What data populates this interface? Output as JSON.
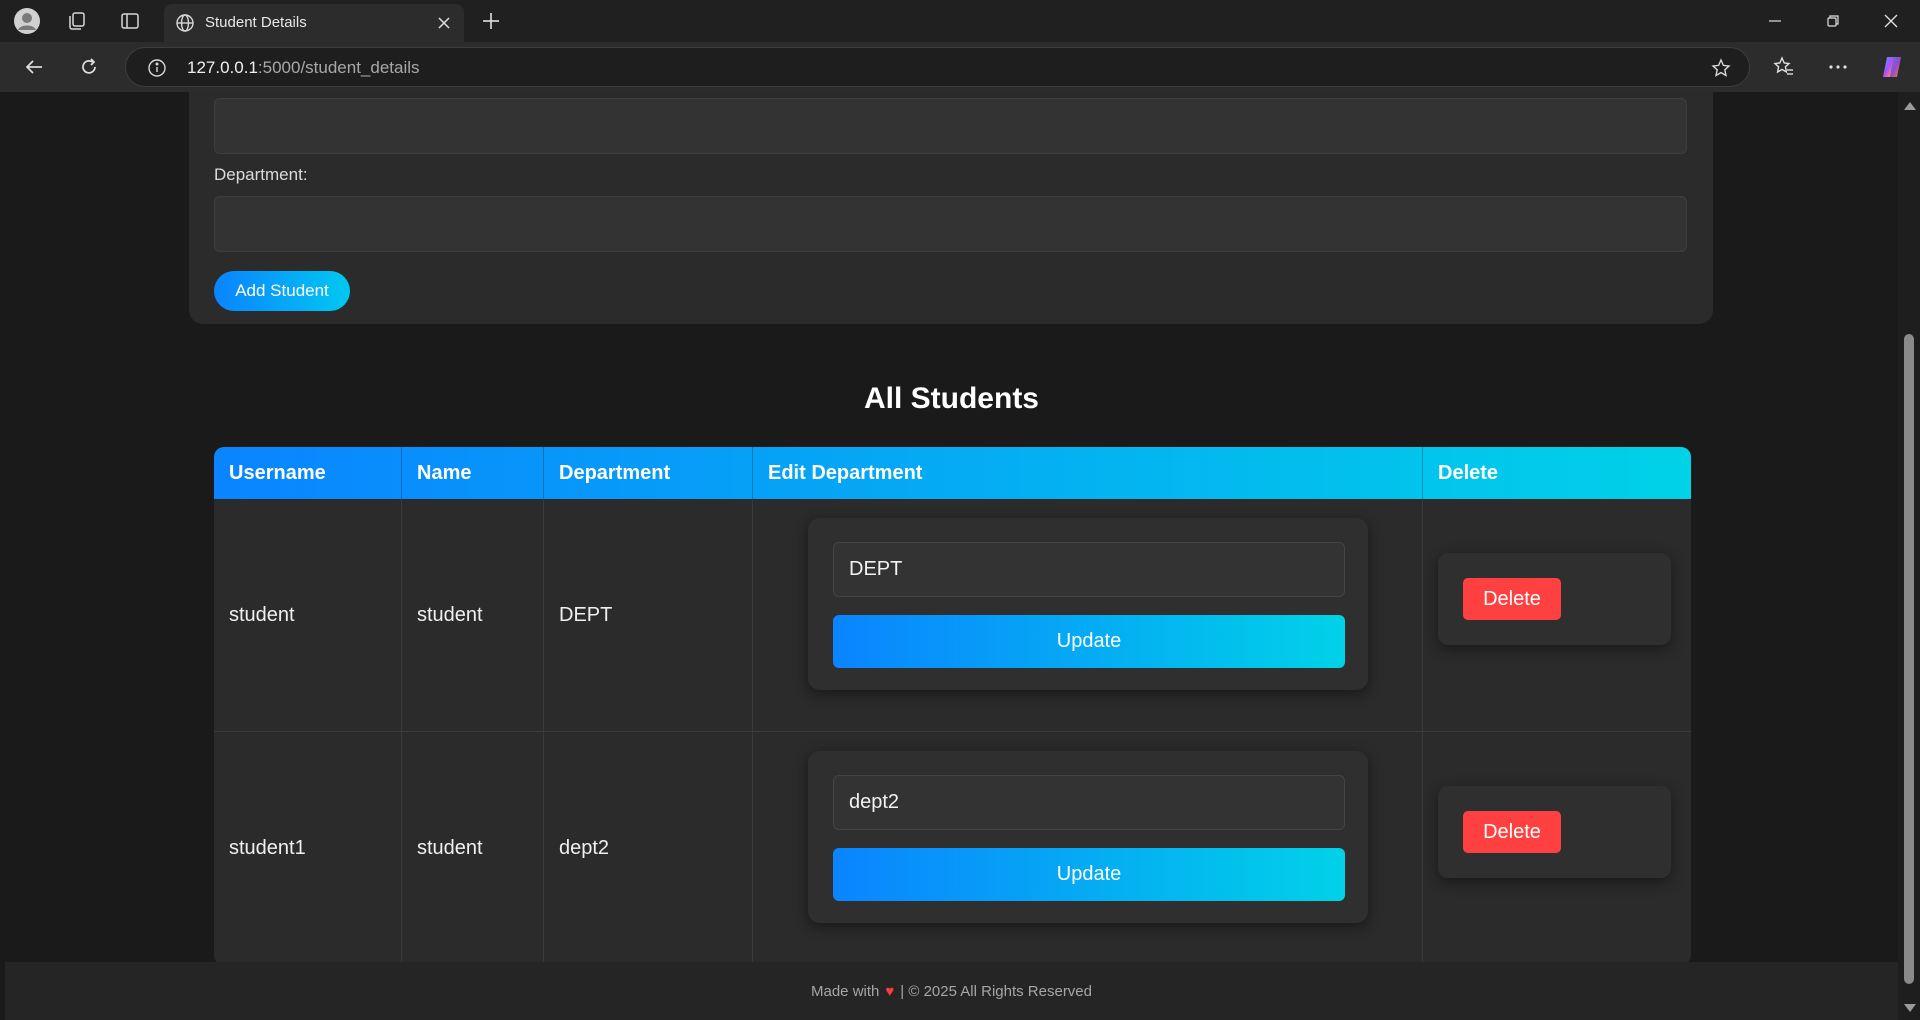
{
  "browser": {
    "tab_title": "Student Details",
    "url_host": "127.0.0.1",
    "url_path": ":5000/student_details"
  },
  "form": {
    "department_label": "Department:",
    "add_button_label": "Add Student"
  },
  "section_title": "All Students",
  "table": {
    "headers": [
      "Username",
      "Name",
      "Department",
      "Edit Department",
      "Delete"
    ],
    "rows": [
      {
        "username": "student",
        "name": "student",
        "department": "DEPT",
        "edit_value": "DEPT",
        "update_label": "Update",
        "delete_label": "Delete"
      },
      {
        "username": "student1",
        "name": "student",
        "department": "dept2",
        "edit_value": "dept2",
        "update_label": "Update",
        "delete_label": "Delete"
      }
    ]
  },
  "footer": {
    "made_with": "Made with",
    "rights": "| © 2025 All Rights Reserved"
  },
  "colors": {
    "accent_gradient_start": "#0a84ff",
    "accent_gradient_end": "#00d2e8",
    "delete_red": "#ff4040"
  }
}
